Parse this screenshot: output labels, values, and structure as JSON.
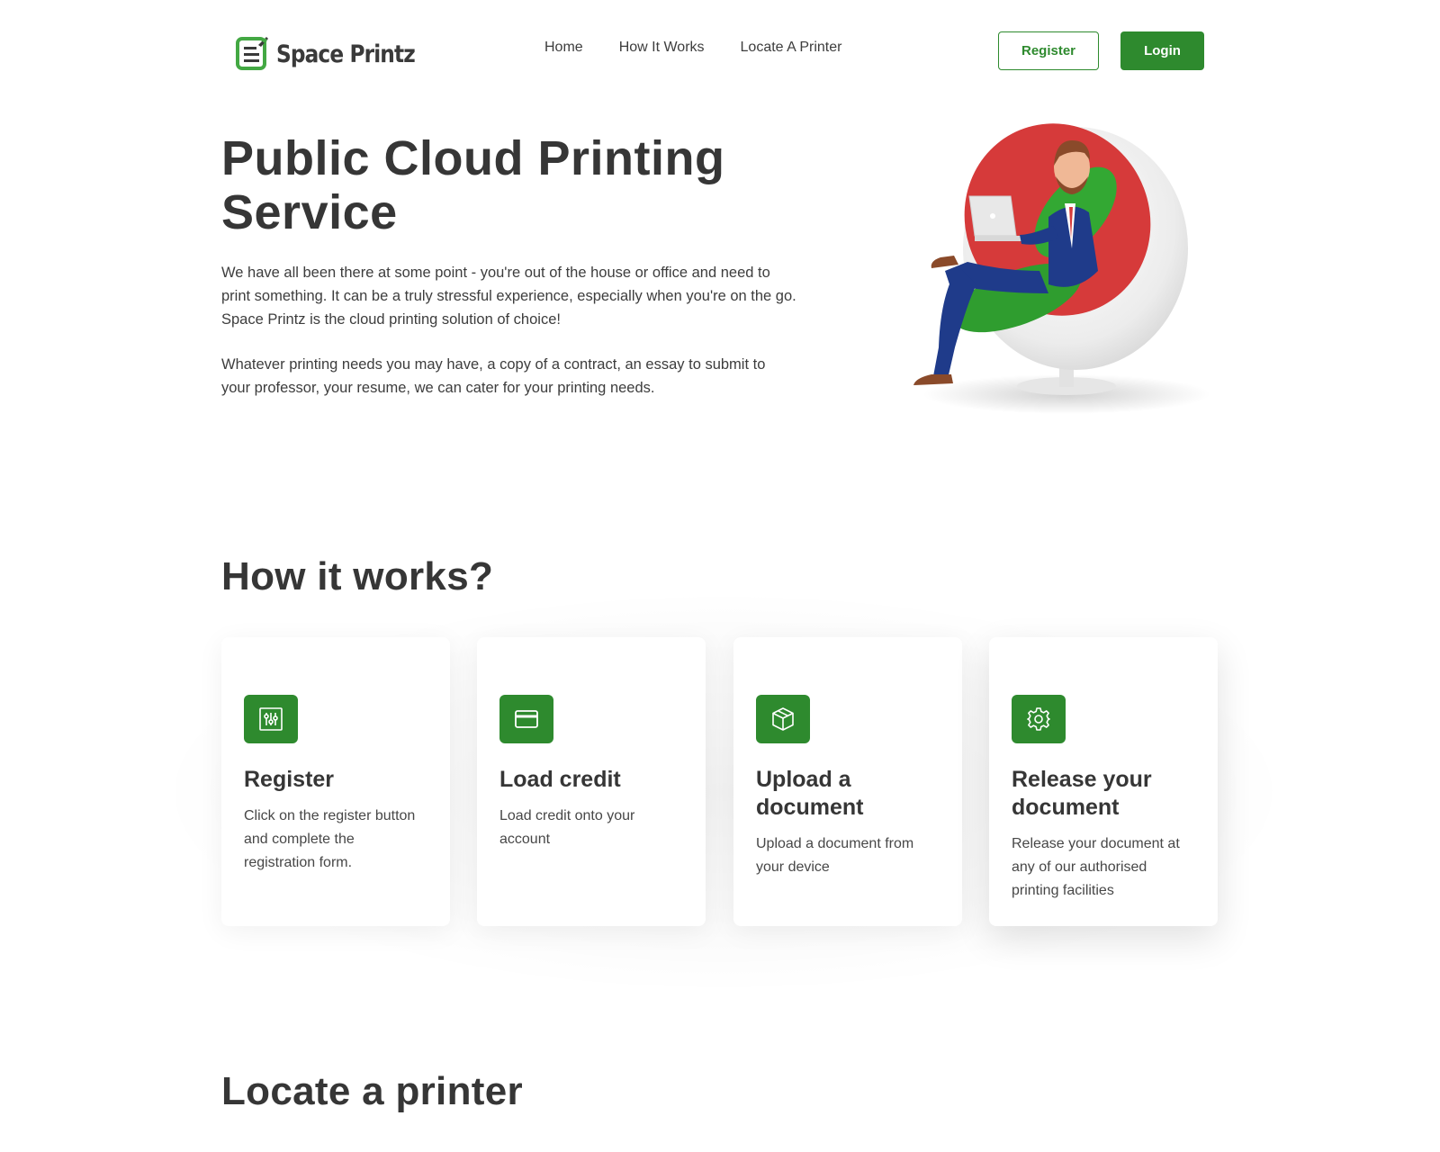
{
  "header": {
    "logo_text": "Space Printz",
    "nav": [
      "Home",
      "How It Works",
      "Locate A Printer"
    ],
    "register_label": "Register",
    "login_label": "Login"
  },
  "hero": {
    "title": "Public Cloud Printing Service",
    "paragraph_1": "We have all been there at some point - you're out of the house or office and need to print something. It can be a truly stressful experience, especially when you're on the go. Space Printz is the cloud printing solution of choice!",
    "paragraph_2": "Whatever printing needs you may have, a copy of a contract, an essay to submit to your professor, your resume, we can cater for your printing needs."
  },
  "how_it_works": {
    "title": "How it works?",
    "cards": [
      {
        "icon": "sliders-icon",
        "title": "Register",
        "text": "Click on the register button and complete the registration form."
      },
      {
        "icon": "credit-card-icon",
        "title": "Load credit",
        "text": "Load credit onto your account"
      },
      {
        "icon": "box-icon",
        "title": "Upload a document",
        "text": "Upload a document from your device"
      },
      {
        "icon": "gear-icon",
        "title": "Release your document",
        "text": "Release your document at any of our authorised printing facilities"
      }
    ]
  },
  "locate": {
    "title": "Locate a printer"
  },
  "colors": {
    "brand_green": "#2e8a2e",
    "heading": "#363636",
    "text": "#3d3d3d"
  }
}
